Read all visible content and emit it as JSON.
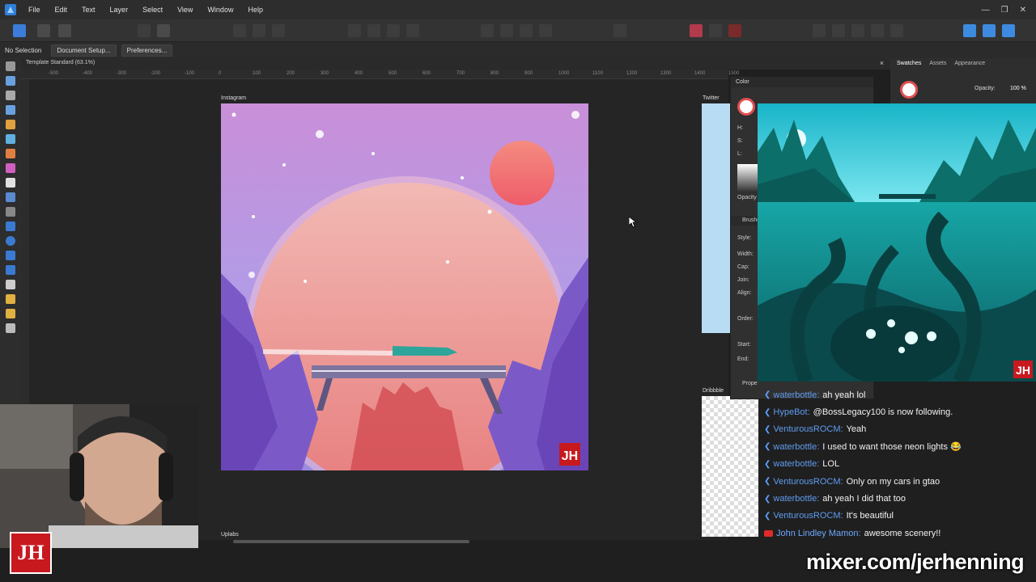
{
  "app": {
    "menu": [
      "File",
      "Edit",
      "Text",
      "Layer",
      "Select",
      "View",
      "Window",
      "Help"
    ]
  },
  "contextbar": {
    "selection": "No Selection",
    "document_setup": "Document Setup...",
    "preferences": "Preferences..."
  },
  "document": {
    "tab_title": "Template Standard (63.1%)",
    "close_glyph": "×"
  },
  "ruler": {
    "ticks": [
      "-500",
      "-400",
      "-300",
      "-200",
      "-100",
      "0",
      "100",
      "200",
      "300",
      "400",
      "500",
      "600",
      "700",
      "800",
      "900",
      "1000",
      "1100",
      "1200",
      "1300",
      "1400",
      "1500"
    ]
  },
  "artboards": {
    "instagram": "Instagram",
    "twitter": "Twitter",
    "dribbble": "Dribbble",
    "uplabs": "Uplabs"
  },
  "right_panel": {
    "tabs": [
      "Swatches",
      "Assets",
      "Appearance"
    ],
    "opacity_label": "Opacity:",
    "opacity_value": "100 %"
  },
  "color_panel": {
    "title": "Color",
    "h": "H:",
    "s": "S:",
    "l": "L:",
    "opacity": "Opacity",
    "brush_title": "Brushe",
    "style": "Style:",
    "width": "Width:",
    "cap": "Cap:",
    "join": "Join:",
    "align": "Align:",
    "order": "Order:",
    "start": "Start:",
    "end": "End:",
    "properties": "Prope"
  },
  "chat": [
    {
      "user": "waterbottle",
      "msg": "ah yeah lol",
      "platform": "mixer"
    },
    {
      "user": "HypeBot",
      "msg": "@BossLegacy100 is now following.",
      "platform": "mixer"
    },
    {
      "user": "VenturousROCM",
      "msg": "Yeah",
      "platform": "mixer"
    },
    {
      "user": "waterbottle",
      "msg": "I used to want those neon lights 😂",
      "platform": "mixer"
    },
    {
      "user": "waterbottle",
      "msg": "LOL",
      "platform": "mixer"
    },
    {
      "user": "VenturousROCM",
      "msg": "Only on my cars in gtao",
      "platform": "mixer"
    },
    {
      "user": "waterbottle",
      "msg": "ah yeah I did that too",
      "platform": "mixer"
    },
    {
      "user": "VenturousROCM",
      "msg": "It's beautiful",
      "platform": "mixer"
    },
    {
      "user": "John Lindley Mamon",
      "msg": "awesome scenery!!",
      "platform": "youtube"
    }
  ],
  "overlay": {
    "url": "mixer.com/jerhenning",
    "logo_text": "JH"
  },
  "colors": {
    "accent": "#3b7dd8",
    "chat_user": "#5f9cf0",
    "logo_red": "#c8191f"
  }
}
